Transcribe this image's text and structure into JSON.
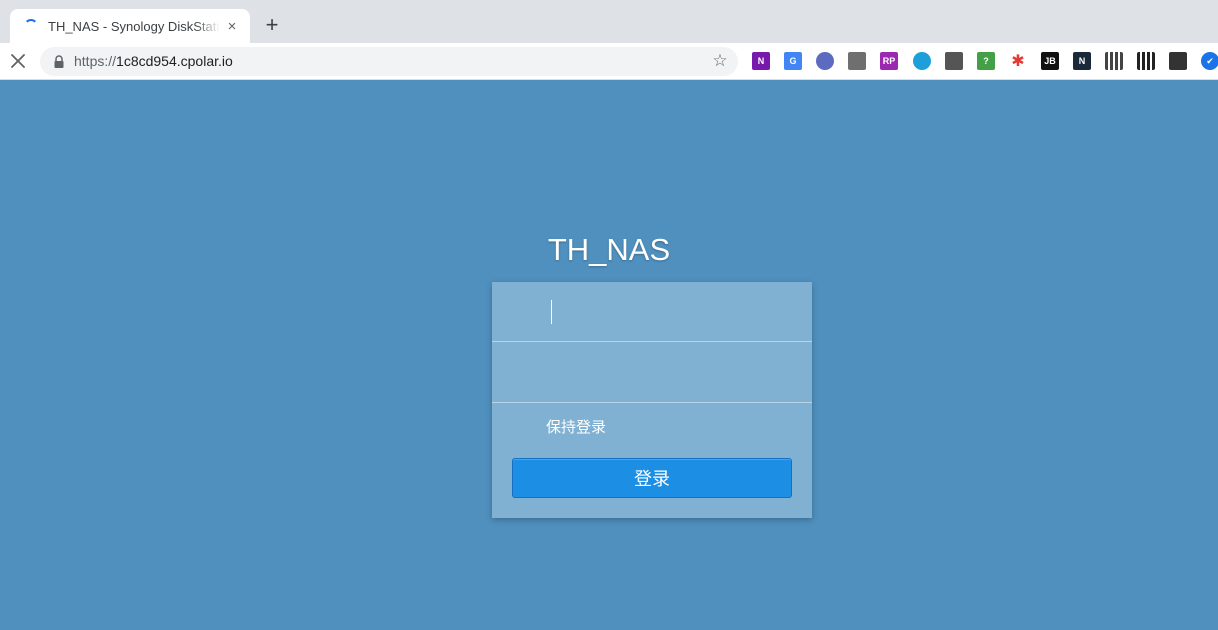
{
  "browser": {
    "tab": {
      "title": "TH_NAS - Synology DiskStation",
      "favicon": "loading-spinner-icon",
      "close_icon": "×"
    },
    "new_tab_icon": "+",
    "address_bar": {
      "scheme": "https://",
      "host": "1c8cd954.cpolar.io",
      "bookmark_icon": "☆"
    },
    "extensions": [
      {
        "name": "onenote-extension-icon",
        "glyph": "N",
        "color": "#7719aa"
      },
      {
        "name": "google-translate-extension-icon",
        "glyph": "G",
        "color": "#4285f4"
      },
      {
        "name": "webpage-capture-extension-icon",
        "glyph": "",
        "color": "#5c6bc0"
      },
      {
        "name": "tampermonkey-extension-icon",
        "glyph": "",
        "color": "#6f6f6f"
      },
      {
        "name": "axure-rp-extension-icon",
        "glyph": "RP",
        "color": "#9c27b0"
      },
      {
        "name": "sync-extension-icon",
        "glyph": "",
        "color": "#1e9fd9"
      },
      {
        "name": "microscope-extension-icon",
        "glyph": "",
        "color": "#555555"
      },
      {
        "name": "download-helper-extension-icon",
        "glyph": "?",
        "color": "#43a047"
      },
      {
        "name": "asterisk-extension-icon",
        "glyph": "✱",
        "color": "#e53935"
      },
      {
        "name": "jetbrains-extension-icon",
        "glyph": "JB",
        "color": "#111111"
      },
      {
        "name": "notion-extension-icon",
        "glyph": "N",
        "color": "#1a2a3a"
      },
      {
        "name": "qr-code-extension-icon",
        "glyph": "",
        "color": "#444444"
      },
      {
        "name": "qr-code-2-extension-icon",
        "glyph": "",
        "color": "#222222"
      },
      {
        "name": "shield-extension-icon",
        "glyph": "",
        "color": "#333333"
      },
      {
        "name": "checkmark-extension-icon",
        "glyph": "✔",
        "color": "#1a73e8"
      }
    ]
  },
  "colors": {
    "page_background": "#5090be",
    "login_panel": "#80b1d2",
    "login_button": "#1c8fe5"
  },
  "login": {
    "title": "TH_NAS",
    "username_value": "",
    "password_value": "",
    "keep_login_label": "保持登录",
    "submit_label": "登录"
  }
}
